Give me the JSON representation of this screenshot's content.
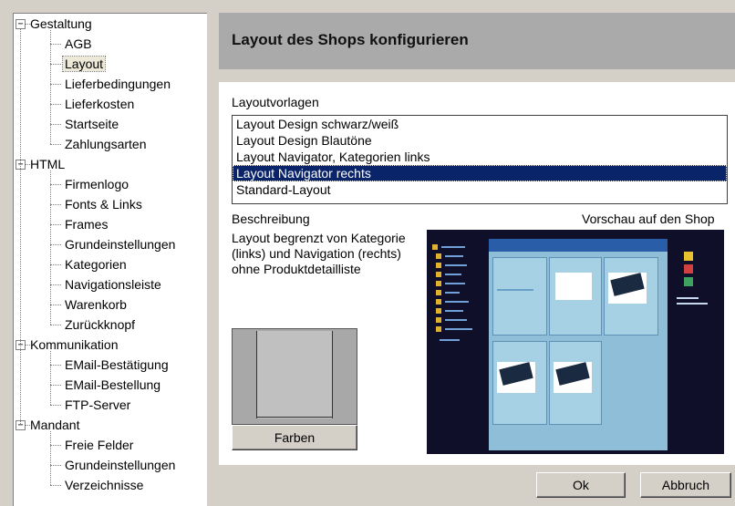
{
  "tree": {
    "items": [
      {
        "label": "Gestaltung",
        "level": 0,
        "expander": "−"
      },
      {
        "label": "AGB",
        "level": 1
      },
      {
        "label": "Layout",
        "level": 1,
        "selected": true
      },
      {
        "label": "Lieferbedingungen",
        "level": 1
      },
      {
        "label": "Lieferkosten",
        "level": 1
      },
      {
        "label": "Startseite",
        "level": 1
      },
      {
        "label": "Zahlungsarten",
        "level": 1
      },
      {
        "label": "HTML",
        "level": 0,
        "expander": "−"
      },
      {
        "label": "Firmenlogo",
        "level": 1
      },
      {
        "label": "Fonts & Links",
        "level": 1
      },
      {
        "label": "Frames",
        "level": 1
      },
      {
        "label": "Grundeinstellungen",
        "level": 1
      },
      {
        "label": "Kategorien",
        "level": 1
      },
      {
        "label": "Navigationsleiste",
        "level": 1
      },
      {
        "label": "Warenkorb",
        "level": 1
      },
      {
        "label": "Zurückknopf",
        "level": 1
      },
      {
        "label": "Kommunikation",
        "level": 0,
        "expander": "−"
      },
      {
        "label": "EMail-Bestätigung",
        "level": 1
      },
      {
        "label": "EMail-Bestellung",
        "level": 1
      },
      {
        "label": "FTP-Server",
        "level": 1
      },
      {
        "label": "Mandant",
        "level": 0,
        "expander": "−"
      },
      {
        "label": "Freie Felder",
        "level": 1
      },
      {
        "label": "Grundeinstellungen",
        "level": 1
      },
      {
        "label": "Verzeichnisse",
        "level": 1
      }
    ]
  },
  "header": {
    "title": "Layout des Shops konfigurieren"
  },
  "templates": {
    "label": "Layoutvorlagen",
    "items": [
      {
        "label": "Layout Design schwarz/weiß"
      },
      {
        "label": "Layout Design Blautöne"
      },
      {
        "label": "Layout Navigator, Kategorien links"
      },
      {
        "label": "Layout Navigator rechts",
        "selected": true
      },
      {
        "label": "Standard-Layout"
      }
    ]
  },
  "description": {
    "label": "Beschreibung",
    "text": "Layout begrenzt von Kategorie (links) und Navigation (rechts) ohne Produktdetailliste"
  },
  "preview": {
    "label": "Vorschau auf den Shop"
  },
  "buttons": {
    "colors": "Farben",
    "ok": "Ok",
    "cancel": "Abbruch"
  },
  "colors": {
    "selection": "#0a246a",
    "header": "#aaaaaa",
    "preview_bg": "#0f0f2a"
  }
}
